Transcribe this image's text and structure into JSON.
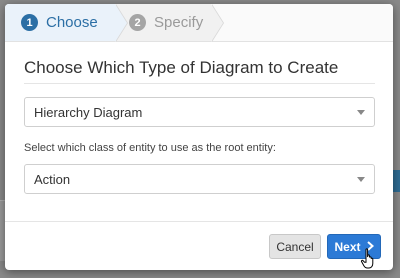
{
  "wizard": {
    "steps": [
      {
        "number": "1",
        "label": "Choose"
      },
      {
        "number": "2",
        "label": "Specify"
      }
    ]
  },
  "dialog": {
    "title": "Choose Which Type of Diagram to Create",
    "diagram_type": {
      "value": "Hierarchy Diagram"
    },
    "root_entity": {
      "label": "Select which class of entity to use as the root entity:",
      "value": "Action"
    }
  },
  "footer": {
    "cancel_label": "Cancel",
    "next_label": "Next",
    "next_icon": "chevron-right-icon"
  },
  "colors": {
    "accent": "#2c7ad6",
    "active_step": "#2c6fa5"
  }
}
